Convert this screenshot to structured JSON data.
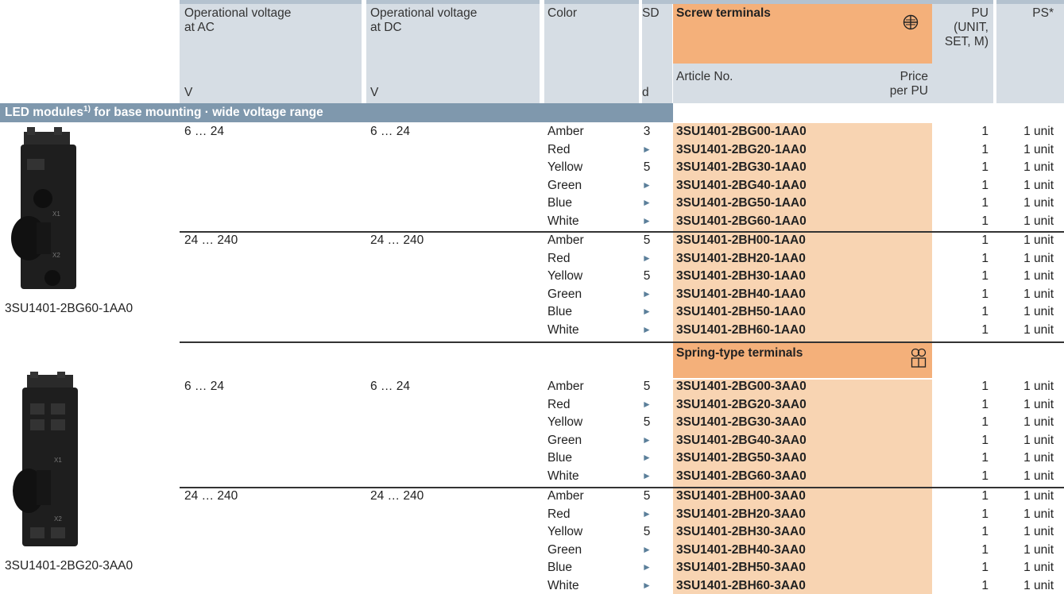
{
  "header": {
    "col_ac": "Operational voltage\nat AC",
    "col_dc": "Operational voltage\nat DC",
    "col_color": "Color",
    "col_sd": "SD",
    "col_screw": "Screw terminals",
    "col_pu": "PU\n(UNIT,\nSET, M)",
    "col_ps": "PS*",
    "unit_ac": "V",
    "unit_dc": "V",
    "unit_sd": "d",
    "article_no": "Article No.",
    "price": "Price\nper PU"
  },
  "section": {
    "title_pre": "LED modules",
    "title_sup": "1)",
    "title_post": " for base mounting · wide voltage range"
  },
  "spring_header": "Spring-type terminals",
  "images": {
    "screw_caption": "3SU1401-2BG60-1AA0",
    "spring_caption": "3SU1401-2BG20-3AA0"
  },
  "groups": [
    {
      "ac": "6 … 24",
      "dc": "6 … 24",
      "rows": [
        {
          "color": "Amber",
          "sd": "3",
          "art": "3SU1401-2BG00-1AA0",
          "pu": "1",
          "ps": "1 unit"
        },
        {
          "color": "Red",
          "sd": "►",
          "art": "3SU1401-2BG20-1AA0",
          "pu": "1",
          "ps": "1 unit"
        },
        {
          "color": "Yellow",
          "sd": "5",
          "art": "3SU1401-2BG30-1AA0",
          "pu": "1",
          "ps": "1 unit"
        },
        {
          "color": "Green",
          "sd": "►",
          "art": "3SU1401-2BG40-1AA0",
          "pu": "1",
          "ps": "1 unit"
        },
        {
          "color": "Blue",
          "sd": "►",
          "art": "3SU1401-2BG50-1AA0",
          "pu": "1",
          "ps": "1 unit"
        },
        {
          "color": "White",
          "sd": "►",
          "art": "3SU1401-2BG60-1AA0",
          "pu": "1",
          "ps": "1 unit"
        }
      ]
    },
    {
      "ac": "24 … 240",
      "dc": "24 … 240",
      "rows": [
        {
          "color": "Amber",
          "sd": "5",
          "art": "3SU1401-2BH00-1AA0",
          "pu": "1",
          "ps": "1 unit"
        },
        {
          "color": "Red",
          "sd": "►",
          "art": "3SU1401-2BH20-1AA0",
          "pu": "1",
          "ps": "1 unit"
        },
        {
          "color": "Yellow",
          "sd": "5",
          "art": "3SU1401-2BH30-1AA0",
          "pu": "1",
          "ps": "1 unit"
        },
        {
          "color": "Green",
          "sd": "►",
          "art": "3SU1401-2BH40-1AA0",
          "pu": "1",
          "ps": "1 unit"
        },
        {
          "color": "Blue",
          "sd": "►",
          "art": "3SU1401-2BH50-1AA0",
          "pu": "1",
          "ps": "1 unit"
        },
        {
          "color": "White",
          "sd": "►",
          "art": "3SU1401-2BH60-1AA0",
          "pu": "1",
          "ps": "1 unit"
        }
      ]
    },
    {
      "ac": "6 … 24",
      "dc": "6 … 24",
      "rows": [
        {
          "color": "Amber",
          "sd": "5",
          "art": "3SU1401-2BG00-3AA0",
          "pu": "1",
          "ps": "1 unit"
        },
        {
          "color": "Red",
          "sd": "►",
          "art": "3SU1401-2BG20-3AA0",
          "pu": "1",
          "ps": "1 unit"
        },
        {
          "color": "Yellow",
          "sd": "5",
          "art": "3SU1401-2BG30-3AA0",
          "pu": "1",
          "ps": "1 unit"
        },
        {
          "color": "Green",
          "sd": "►",
          "art": "3SU1401-2BG40-3AA0",
          "pu": "1",
          "ps": "1 unit"
        },
        {
          "color": "Blue",
          "sd": "►",
          "art": "3SU1401-2BG50-3AA0",
          "pu": "1",
          "ps": "1 unit"
        },
        {
          "color": "White",
          "sd": "►",
          "art": "3SU1401-2BG60-3AA0",
          "pu": "1",
          "ps": "1 unit"
        }
      ]
    },
    {
      "ac": "24 … 240",
      "dc": "24 … 240",
      "rows": [
        {
          "color": "Amber",
          "sd": "5",
          "art": "3SU1401-2BH00-3AA0",
          "pu": "1",
          "ps": "1 unit"
        },
        {
          "color": "Red",
          "sd": "►",
          "art": "3SU1401-2BH20-3AA0",
          "pu": "1",
          "ps": "1 unit"
        },
        {
          "color": "Yellow",
          "sd": "5",
          "art": "3SU1401-2BH30-3AA0",
          "pu": "1",
          "ps": "1 unit"
        },
        {
          "color": "Green",
          "sd": "►",
          "art": "3SU1401-2BH40-3AA0",
          "pu": "1",
          "ps": "1 unit"
        },
        {
          "color": "Blue",
          "sd": "►",
          "art": "3SU1401-2BH50-3AA0",
          "pu": "1",
          "ps": "1 unit"
        },
        {
          "color": "White",
          "sd": "►",
          "art": "3SU1401-2BH60-3AA0",
          "pu": "1",
          "ps": "1 unit"
        }
      ]
    }
  ]
}
